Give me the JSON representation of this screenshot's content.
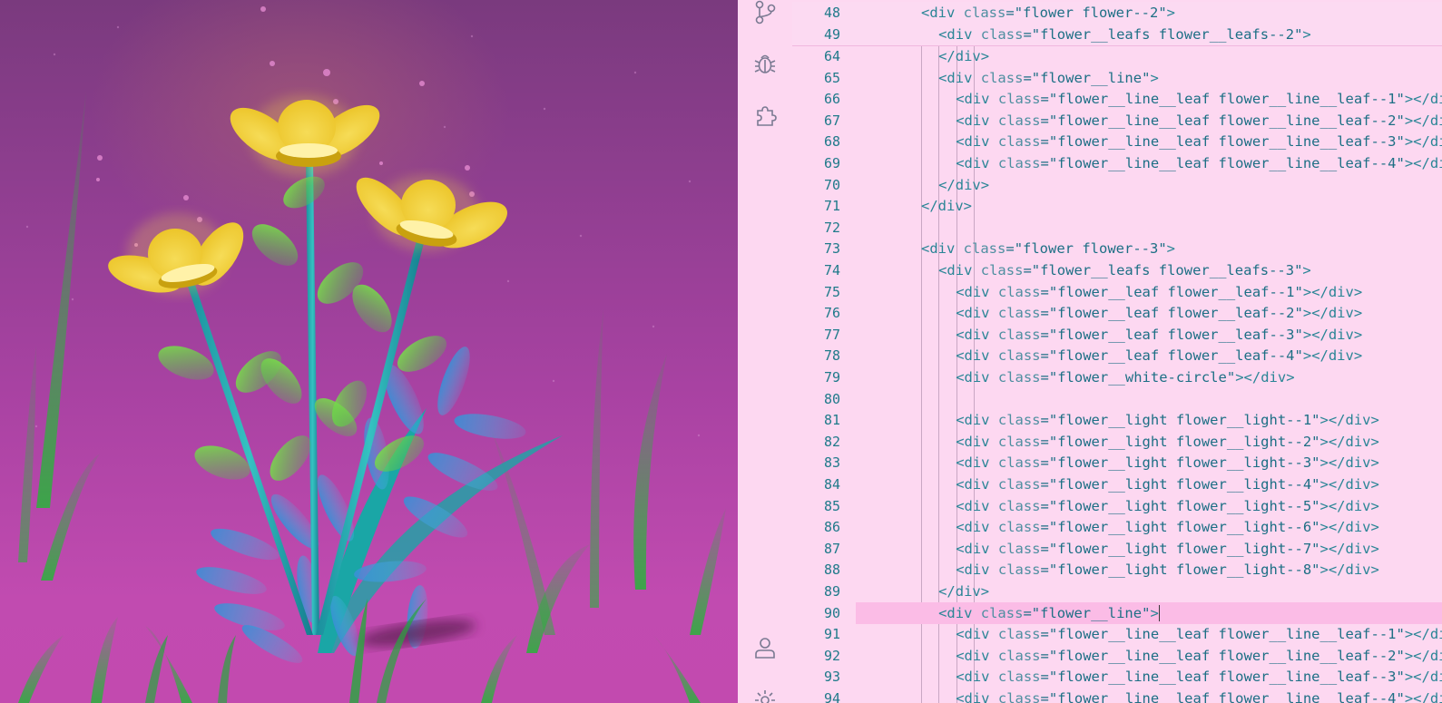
{
  "editor": {
    "sticky_lines": [
      {
        "num": "48",
        "indent": 7,
        "tag": "div",
        "attr": "class",
        "value": "flower flower--2",
        "close": false
      },
      {
        "num": "49",
        "indent": 8,
        "tag": "div",
        "attr": "class",
        "value": "flower__leafs flower__leafs--2",
        "close": false
      }
    ],
    "lines": [
      {
        "num": "64",
        "indent": 8,
        "kind": "close",
        "tag": "div"
      },
      {
        "num": "65",
        "indent": 8,
        "kind": "open",
        "tag": "div",
        "attr": "class",
        "value": "flower__line"
      },
      {
        "num": "66",
        "indent": 9,
        "kind": "pair",
        "tag": "div",
        "attr": "class",
        "value": "flower__line__leaf flower__line__leaf--1"
      },
      {
        "num": "67",
        "indent": 9,
        "kind": "pair",
        "tag": "div",
        "attr": "class",
        "value": "flower__line__leaf flower__line__leaf--2"
      },
      {
        "num": "68",
        "indent": 9,
        "kind": "pair",
        "tag": "div",
        "attr": "class",
        "value": "flower__line__leaf flower__line__leaf--3"
      },
      {
        "num": "69",
        "indent": 9,
        "kind": "pair",
        "tag": "div",
        "attr": "class",
        "value": "flower__line__leaf flower__line__leaf--4"
      },
      {
        "num": "70",
        "indent": 8,
        "kind": "close",
        "tag": "div"
      },
      {
        "num": "71",
        "indent": 7,
        "kind": "close",
        "tag": "div"
      },
      {
        "num": "72",
        "indent": 0,
        "kind": "empty"
      },
      {
        "num": "73",
        "indent": 7,
        "kind": "open",
        "tag": "div",
        "attr": "class",
        "value": "flower flower--3"
      },
      {
        "num": "74",
        "indent": 8,
        "kind": "open",
        "tag": "div",
        "attr": "class",
        "value": "flower__leafs flower__leafs--3"
      },
      {
        "num": "75",
        "indent": 9,
        "kind": "pair",
        "tag": "div",
        "attr": "class",
        "value": "flower__leaf flower__leaf--1"
      },
      {
        "num": "76",
        "indent": 9,
        "kind": "pair",
        "tag": "div",
        "attr": "class",
        "value": "flower__leaf flower__leaf--2"
      },
      {
        "num": "77",
        "indent": 9,
        "kind": "pair",
        "tag": "div",
        "attr": "class",
        "value": "flower__leaf flower__leaf--3"
      },
      {
        "num": "78",
        "indent": 9,
        "kind": "pair",
        "tag": "div",
        "attr": "class",
        "value": "flower__leaf flower__leaf--4"
      },
      {
        "num": "79",
        "indent": 9,
        "kind": "pair",
        "tag": "div",
        "attr": "class",
        "value": "flower__white-circle"
      },
      {
        "num": "80",
        "indent": 0,
        "kind": "empty"
      },
      {
        "num": "81",
        "indent": 9,
        "kind": "pair",
        "tag": "div",
        "attr": "class",
        "value": "flower__light flower__light--1"
      },
      {
        "num": "82",
        "indent": 9,
        "kind": "pair",
        "tag": "div",
        "attr": "class",
        "value": "flower__light flower__light--2"
      },
      {
        "num": "83",
        "indent": 9,
        "kind": "pair",
        "tag": "div",
        "attr": "class",
        "value": "flower__light flower__light--3"
      },
      {
        "num": "84",
        "indent": 9,
        "kind": "pair",
        "tag": "div",
        "attr": "class",
        "value": "flower__light flower__light--4"
      },
      {
        "num": "85",
        "indent": 9,
        "kind": "pair",
        "tag": "div",
        "attr": "class",
        "value": "flower__light flower__light--5"
      },
      {
        "num": "86",
        "indent": 9,
        "kind": "pair",
        "tag": "div",
        "attr": "class",
        "value": "flower__light flower__light--6"
      },
      {
        "num": "87",
        "indent": 9,
        "kind": "pair",
        "tag": "div",
        "attr": "class",
        "value": "flower__light flower__light--7"
      },
      {
        "num": "88",
        "indent": 9,
        "kind": "pair",
        "tag": "div",
        "attr": "class",
        "value": "flower__light flower__light--8"
      },
      {
        "num": "89",
        "indent": 8,
        "kind": "close",
        "tag": "div"
      },
      {
        "num": "90",
        "indent": 8,
        "kind": "open",
        "tag": "div",
        "attr": "class",
        "value": "flower__line",
        "current": true
      },
      {
        "num": "91",
        "indent": 9,
        "kind": "pair",
        "tag": "div",
        "attr": "class",
        "value": "flower__line__leaf flower__line__leaf--1"
      },
      {
        "num": "92",
        "indent": 9,
        "kind": "pair",
        "tag": "div",
        "attr": "class",
        "value": "flower__line__leaf flower__line__leaf--2"
      },
      {
        "num": "93",
        "indent": 9,
        "kind": "pair",
        "tag": "div",
        "attr": "class",
        "value": "flower__line__leaf flower__line__leaf--3"
      },
      {
        "num": "94",
        "indent": 9,
        "kind": "pair",
        "tag": "div",
        "attr": "class",
        "value": "flower__line__leaf flower__line__leaf--4"
      }
    ]
  },
  "activity_bar": {
    "icons": [
      "source-control-icon",
      "debug-icon",
      "extensions-icon",
      "account-icon",
      "settings-icon"
    ]
  },
  "colors": {
    "editor_bg": "#fdd8f1",
    "current_line": "#fbbce6",
    "petal": "#f2cd3a",
    "stem": "#1ea3a8",
    "leaf": "#6fd24a"
  }
}
